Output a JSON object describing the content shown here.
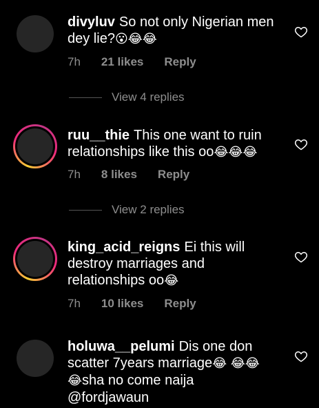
{
  "comments": [
    {
      "username": "divyluv",
      "text": "So not only Nigerian men dey lie?",
      "emojis": "😮😂😂",
      "time": "7h",
      "likes": "21 likes",
      "reply": "Reply",
      "view_replies": "View 4 replies"
    },
    {
      "username": "ruu__thie",
      "text": "This one want to ruin relationships like this oo",
      "emojis": "😂😂😂",
      "time": "7h",
      "likes": "8 likes",
      "reply": "Reply",
      "view_replies": "View 2 replies"
    },
    {
      "username": "king_acid_reigns",
      "text": "Ei  this will destroy marriages and relationships oo",
      "emojis": "😂",
      "time": "7h",
      "likes": "10 likes",
      "reply": "Reply"
    },
    {
      "username": "holuwa__pelumi",
      "text": "Dis one don scatter 7years marriage",
      "emojis": "😂",
      "text2_emojis": "😂😂😂",
      "text2": "sha no come naija",
      "mention": "@fordjawaun"
    }
  ]
}
